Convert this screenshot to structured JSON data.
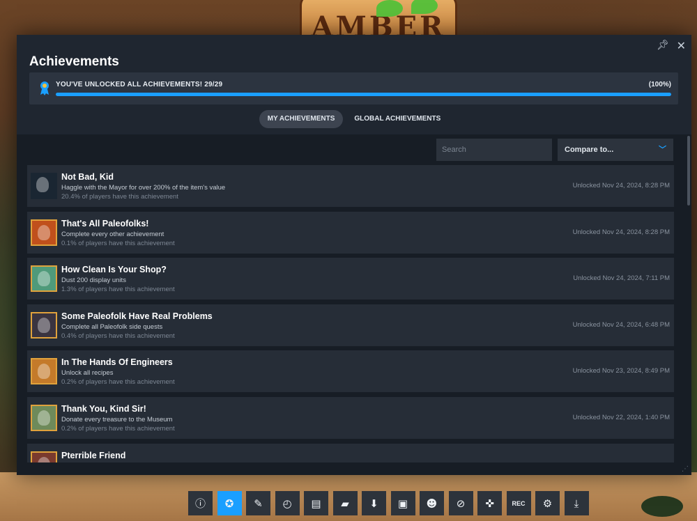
{
  "game_background": {
    "sign_text": "AMBER"
  },
  "panel": {
    "title": "Achievements",
    "pin_icon": "pin-icon",
    "close_icon": "close-icon"
  },
  "progress": {
    "text": "YOU'VE UNLOCKED ALL ACHIEVEMENTS! 29/29",
    "percent_label": "(100%)",
    "fraction": 1.0
  },
  "tabs": [
    {
      "label": "MY ACHIEVEMENTS",
      "active": true
    },
    {
      "label": "GLOBAL ACHIEVEMENTS",
      "active": false
    }
  ],
  "search": {
    "placeholder": "Search"
  },
  "compare": {
    "label": "Compare to..."
  },
  "achievements": [
    {
      "name": "Not Bad, Kid",
      "desc": "Haggle with the Mayor for over 200% of the item's value",
      "pct": "20.4% of players have this achievement",
      "date": "Unlocked Nov 24, 2024, 8:28 PM",
      "rare": false,
      "icon_color": "#1a2632"
    },
    {
      "name": "That's All Paleofolks!",
      "desc": "Complete every other achievement",
      "pct": "0.1% of players have this achievement",
      "date": "Unlocked Nov 24, 2024, 8:28 PM",
      "rare": true,
      "icon_color": "#c0501c"
    },
    {
      "name": "How Clean Is Your Shop?",
      "desc": "Dust 200 display units",
      "pct": "1.3% of players have this achievement",
      "date": "Unlocked Nov 24, 2024, 7:11 PM",
      "rare": true,
      "icon_color": "#4f9a7a"
    },
    {
      "name": "Some Paleofolk Have Real Problems",
      "desc": "Complete all Paleofolk side quests",
      "pct": "0.4% of players have this achievement",
      "date": "Unlocked Nov 24, 2024, 6:48 PM",
      "rare": true,
      "icon_color": "#3a3440"
    },
    {
      "name": "In The Hands Of Engineers",
      "desc": "Unlock all recipes",
      "pct": "0.2% of players have this achievement",
      "date": "Unlocked Nov 23, 2024, 8:49 PM",
      "rare": true,
      "icon_color": "#c47a2a"
    },
    {
      "name": "Thank You, Kind Sir!",
      "desc": "Donate every treasure to the Museum",
      "pct": "0.2% of players have this achievement",
      "date": "Unlocked Nov 22, 2024, 1:40 PM",
      "rare": true,
      "icon_color": "#6e8a5a"
    },
    {
      "name": "Pterrible Friend",
      "desc": "",
      "pct": "",
      "date": "",
      "rare": true,
      "icon_color": "#7a3a2e"
    }
  ],
  "toolbar": [
    {
      "name": "info-icon",
      "glyph": "ⓘ",
      "active": false
    },
    {
      "name": "achievements-icon",
      "glyph": "✪",
      "active": true
    },
    {
      "name": "notes-pencil-icon",
      "glyph": "✎",
      "active": false
    },
    {
      "name": "recent-activity-clock-icon",
      "glyph": "◴",
      "active": false
    },
    {
      "name": "guides-book-icon",
      "glyph": "▤",
      "active": false
    },
    {
      "name": "discussions-icon",
      "glyph": "▰",
      "active": false
    },
    {
      "name": "downloads-icon",
      "glyph": "⬇",
      "active": false
    },
    {
      "name": "screenshots-icon",
      "glyph": "▣",
      "active": false
    },
    {
      "name": "friends-icon",
      "glyph": "☻",
      "active": false
    },
    {
      "name": "browser-compass-icon",
      "glyph": "⊘",
      "active": false
    },
    {
      "name": "controller-icon",
      "glyph": "✜",
      "active": false
    },
    {
      "name": "recording-icon",
      "glyph": "REC",
      "active": false
    },
    {
      "name": "settings-gear-icon",
      "glyph": "⚙",
      "active": false
    },
    {
      "name": "minimize-icon",
      "glyph": "⤓",
      "active": false
    }
  ]
}
